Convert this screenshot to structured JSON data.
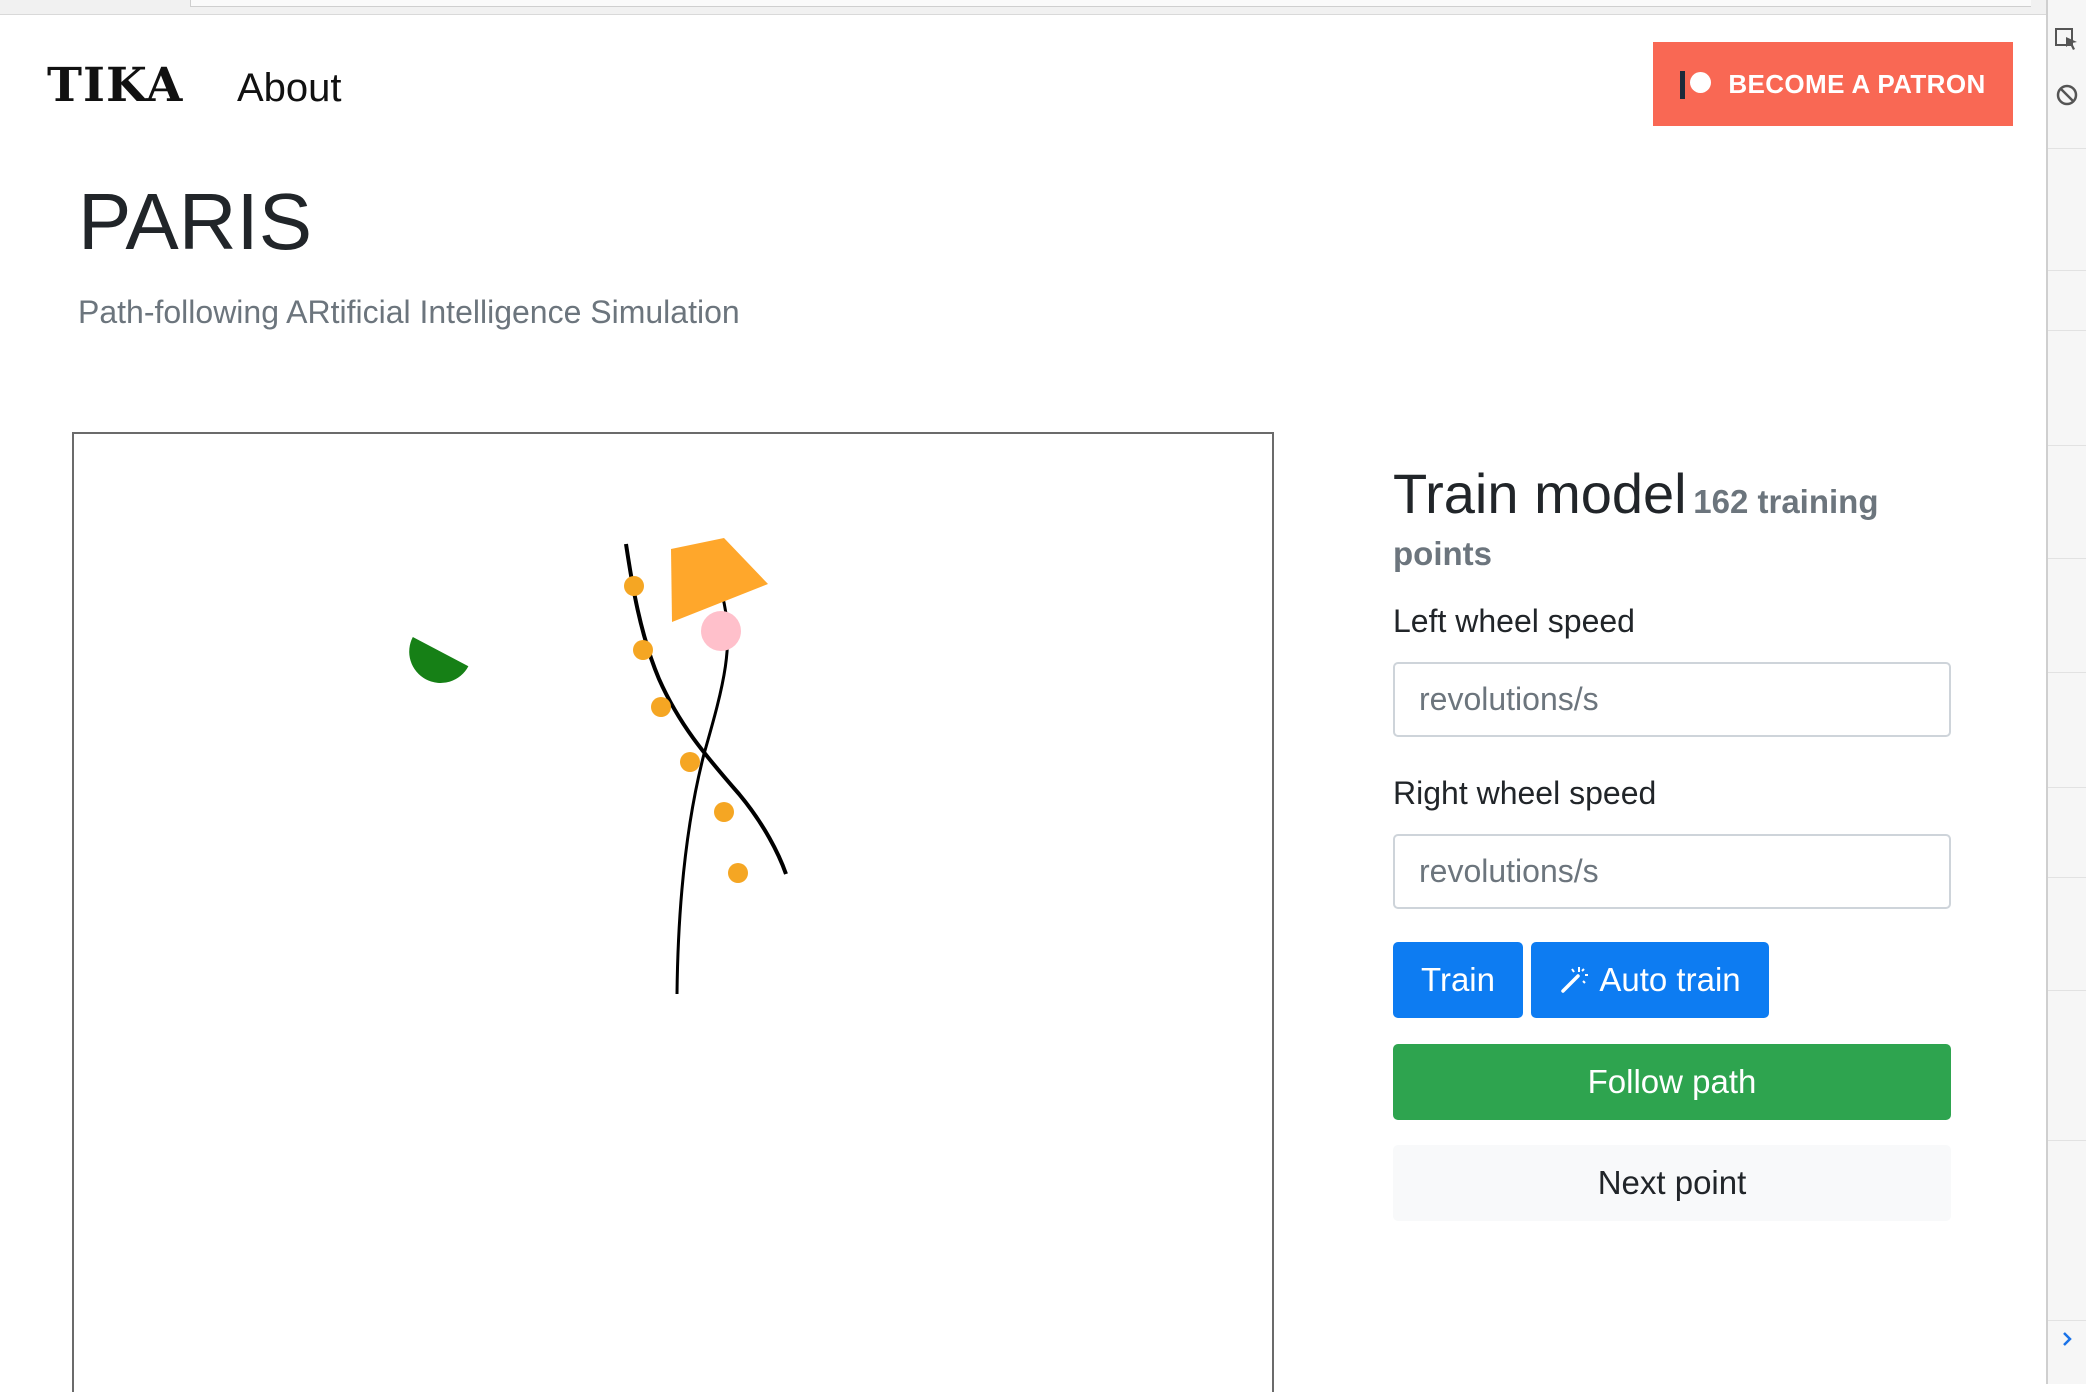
{
  "nav": {
    "brand": "TIKA",
    "about_label": "About",
    "patron_label": "BECOME A PATRON",
    "patron_color": "#f96854"
  },
  "header": {
    "title": "PARIS",
    "subtitle": "Path-following ARtificial Intelligence Simulation"
  },
  "simulation": {
    "robot_color": "#ffa72b",
    "target_color": "#ffc0cb",
    "obstacle_color": "#168016",
    "path_point_color": "#f5a623",
    "path_points_visible": 6
  },
  "train": {
    "title": "Train model",
    "training_points": "162 training points",
    "left_label": "Left wheel speed",
    "left_placeholder": "revolutions/s",
    "right_label": "Right wheel speed",
    "right_placeholder": "revolutions/s",
    "train_button": "Train",
    "auto_train_button": "Auto train",
    "follow_path_button": "Follow path",
    "next_point_button": "Next point"
  },
  "colors": {
    "primary": "#0d7cf2",
    "success": "#2ea44f",
    "light": "#f8f9fa",
    "muted": "#6c757d"
  },
  "devtools": {
    "icons": [
      "cursor-icon",
      "block-icon",
      "chevron-right-icon"
    ]
  }
}
